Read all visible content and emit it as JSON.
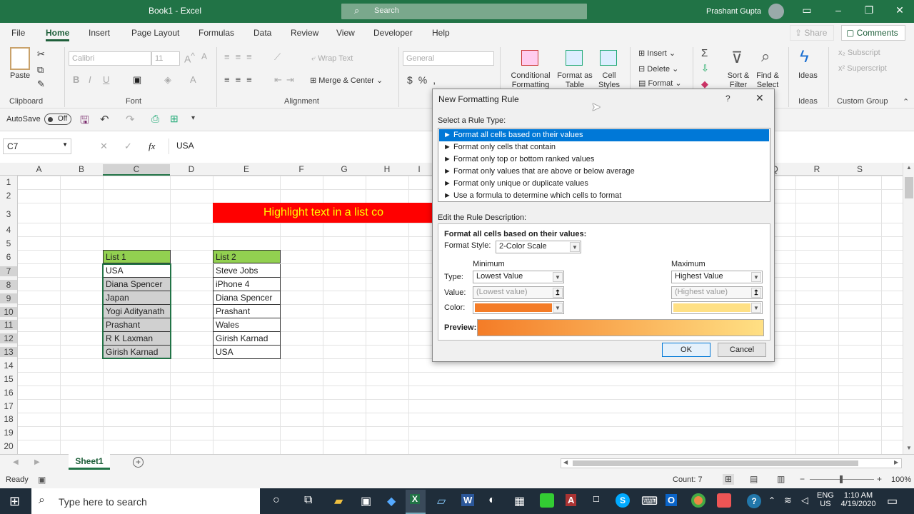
{
  "window": {
    "title": "Book1 - Excel",
    "search_placeholder": "Search",
    "user": "Prashant Gupta"
  },
  "tabs": [
    "File",
    "Home",
    "Insert",
    "Page Layout",
    "Formulas",
    "Data",
    "Review",
    "View",
    "Developer",
    "Help"
  ],
  "share_label": "Share",
  "comments_label": "Comments",
  "ribbon": {
    "paste": "Paste",
    "clipboard": "Clipboard",
    "font_name": "Calibri",
    "font_size": "11",
    "font": "Font",
    "wrap_text": "Wrap Text",
    "merge_center": "Merge & Center",
    "alignment": "Alignment",
    "number_format": "General",
    "conditional_formatting": "Conditional Formatting",
    "format_as_table": "Format as Table",
    "cell_styles": "Cell Styles",
    "insert": "Insert",
    "delete": "Delete",
    "format": "Format",
    "sort_filter": "Sort & Filter",
    "find_select": "Find & Select",
    "ideas": "Ideas",
    "ideas_group": "Ideas",
    "subscript": "Subscript",
    "superscript": "Superscript",
    "custom_group": "Custom Group"
  },
  "qat": {
    "autosave": "AutoSave",
    "toggle": "Off"
  },
  "formula_bar": {
    "name_box": "C7",
    "formula": "USA"
  },
  "columns": [
    "A",
    "B",
    "C",
    "D",
    "E",
    "F",
    "G",
    "H",
    "I",
    "Q",
    "R",
    "S"
  ],
  "rows": [
    "1",
    "2",
    "3",
    "4",
    "5",
    "6",
    "7",
    "8",
    "9",
    "10",
    "11",
    "12",
    "13",
    "14",
    "15",
    "16",
    "17",
    "18",
    "19",
    "20"
  ],
  "banner": "Highlight text in a list co",
  "list1": {
    "header": "List 1",
    "items": [
      "USA",
      "Diana Spencer",
      "Japan",
      "Yogi Adityanath",
      "Prashant",
      "R K Laxman",
      "Girish Karnad"
    ]
  },
  "list2": {
    "header": "List 2",
    "items": [
      "Steve Jobs",
      "iPhone 4",
      "Diana Spencer",
      "Prashant",
      "Wales",
      "Girish Karnad",
      "USA"
    ]
  },
  "sheet_tab": "Sheet1",
  "status": {
    "ready": "Ready",
    "count": "Count: 7",
    "zoom": "100%"
  },
  "taskbar": {
    "search": "Type here to search",
    "lang1": "ENG",
    "lang2": "US",
    "time": "1:10 AM",
    "date": "4/19/2020"
  },
  "dialog": {
    "title": "New Formatting Rule",
    "select_rule_type": "Select a Rule Type:",
    "rule_types": [
      "► Format all cells based on their values",
      "► Format only cells that contain",
      "► Format only top or bottom ranked values",
      "► Format only values that are above or below average",
      "► Format only unique or duplicate values",
      "► Use a formula to determine which cells to format"
    ],
    "edit_rule_desc": "Edit the Rule Description:",
    "desc_heading": "Format all cells based on their values:",
    "format_style_label": "Format Style:",
    "format_style": "2-Color Scale",
    "minimum": "Minimum",
    "maximum": "Maximum",
    "type_label": "Type:",
    "value_label": "Value:",
    "color_label": "Color:",
    "min_type": "Lowest Value",
    "max_type": "Highest Value",
    "min_value": "(Lowest value)",
    "max_value": "(Highest value)",
    "min_color": "#f47c27",
    "max_color": "#ffe084",
    "preview_label": "Preview:",
    "ok": "OK",
    "cancel": "Cancel"
  },
  "colors": {
    "excel_green": "#217346",
    "header_green": "#92d050",
    "banner_red": "#ff0000",
    "banner_text": "#ffff00",
    "selection_blue": "#0078d7"
  }
}
